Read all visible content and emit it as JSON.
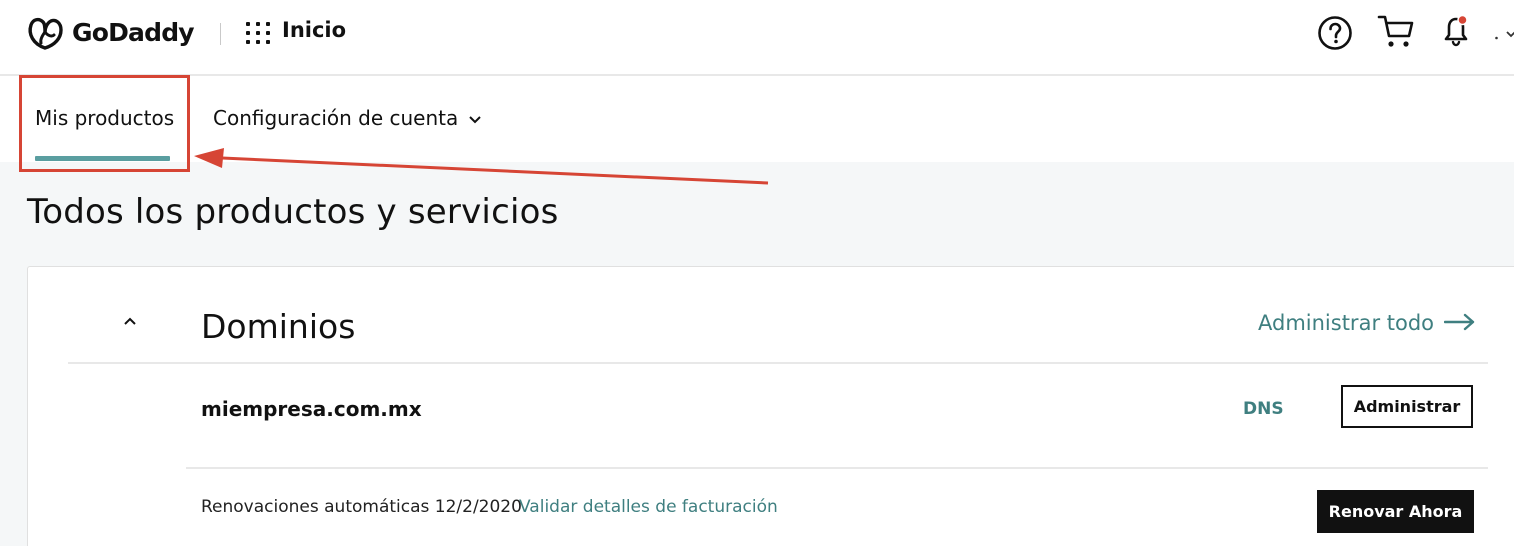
{
  "header": {
    "brand": "GoDaddy",
    "home_label": "Inicio",
    "icons": [
      "godaddy-logo-icon",
      "apps-grid-icon",
      "help-icon",
      "cart-icon",
      "bell-icon"
    ]
  },
  "tabs": [
    {
      "label": "Mis productos",
      "active": true
    },
    {
      "label": "Configuración de cuenta",
      "active": false
    }
  ],
  "main": {
    "title": "Todos los productos y servicios",
    "section": {
      "title": "Dominios",
      "manage_all_label": "Administrar todo",
      "domain": {
        "name": "miempresa.com.mx",
        "dns_label": "DNS",
        "manage_label": "Administrar"
      },
      "renewal": {
        "text": "Renovaciones automáticas 12/2/2020",
        "billing_link": "Validar detalles de facturación",
        "renew_label": "Renovar Ahora"
      }
    }
  },
  "colors": {
    "accent": "#5a9ea0",
    "link": "#3f7f80",
    "annotation": "#d64535",
    "background": "#f5f7f8"
  }
}
